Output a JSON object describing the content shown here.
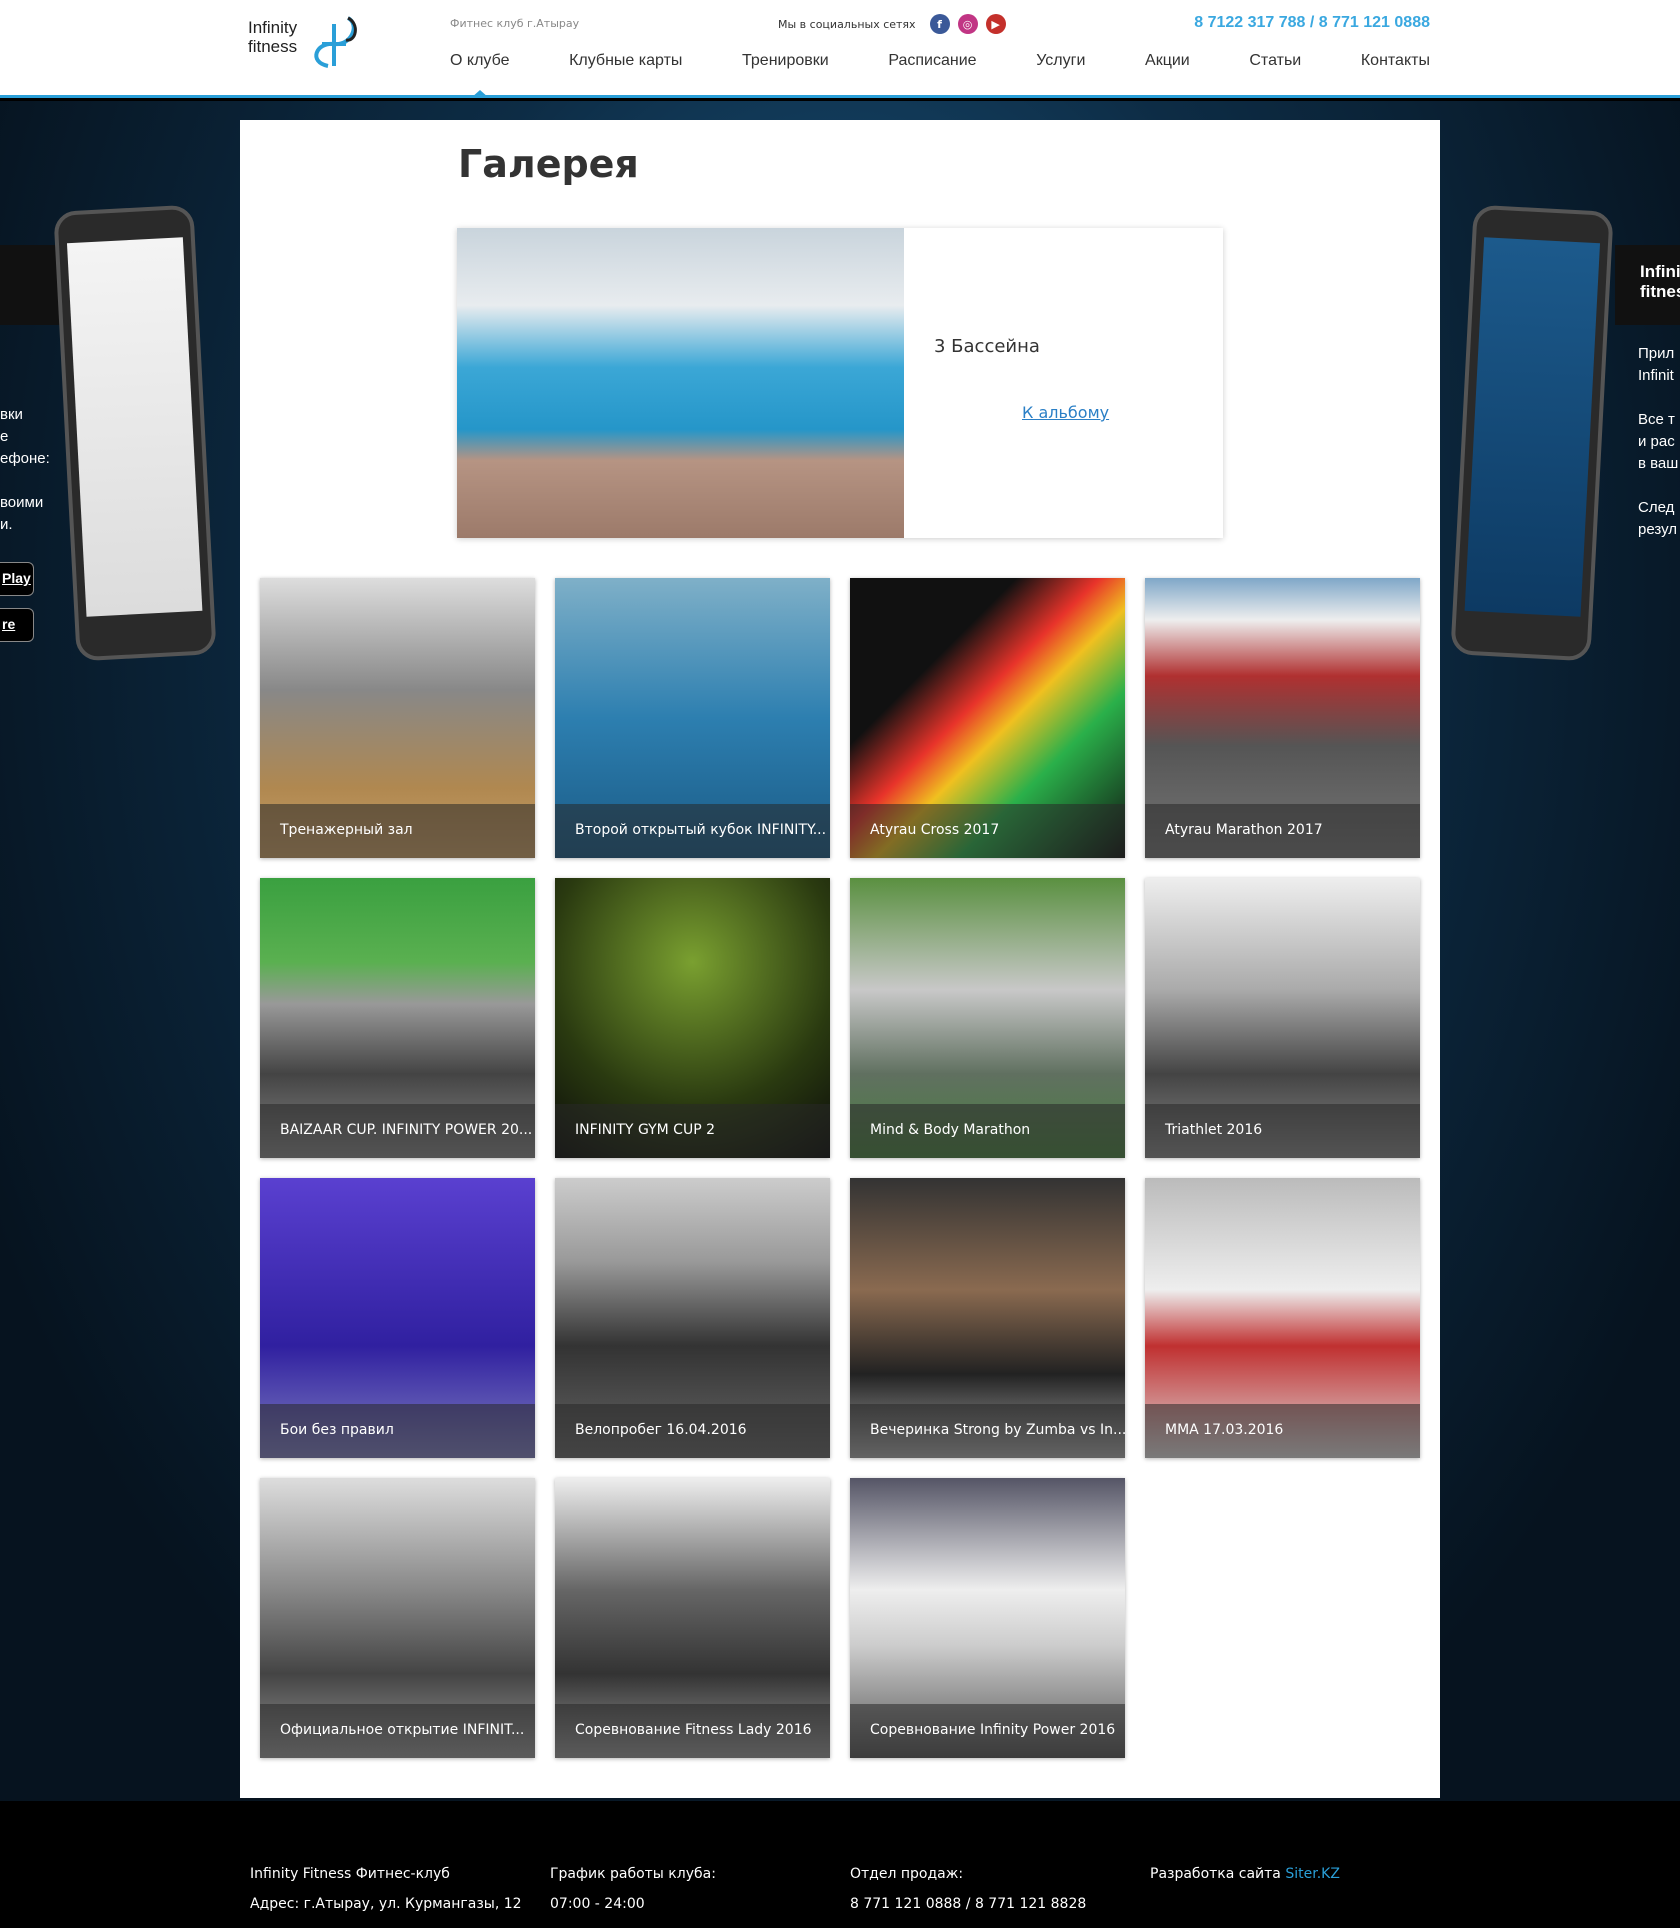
{
  "header": {
    "logo_text_1": "Infinity",
    "logo_text_2": "fitness",
    "tagline": "Фитнес клуб г.Атырау",
    "social_label": "Мы в социальных сетях",
    "social": [
      {
        "icon": "facebook-icon",
        "glyph": "f",
        "color": "#3b5998"
      },
      {
        "icon": "instagram-icon",
        "glyph": "◎",
        "color": "#c13584"
      },
      {
        "icon": "youtube-icon",
        "glyph": "▶",
        "color": "#c4302b"
      }
    ],
    "phone": "8 7122 317 788 / 8 771 121 0888",
    "accent": "#2a9fd8"
  },
  "nav": [
    "О клубе",
    "Клубные карты",
    "Тренировки",
    "Расписание",
    "Услуги",
    "Акции",
    "Статьи",
    "Контакты"
  ],
  "side": {
    "left_text": "вки\nе\nефоне:\n\nвоими\nи.",
    "left_btn1": "Play",
    "left_btn2": "re",
    "right_logo": "Infini\nfitnes",
    "right_text": "Прил\nInfinit\n\nВсе т\nи рас\nв ваш\n\nСлед\nрезул"
  },
  "main": {
    "title": "Галерея",
    "featured": {
      "name": "3 Бассейна",
      "link": "К альбому"
    },
    "albums": [
      {
        "title": "Тренажерный зал",
        "bg": "linear-gradient(#ddd 0%,#888 40%,#b08850 75%,#caa068 100%)"
      },
      {
        "title": "Второй открытый кубок INFINITY...",
        "bg": "linear-gradient(#7fb0c8,#2d7fb0 50%,#1a5a85)"
      },
      {
        "title": "Atyrau Cross 2017",
        "bg": "linear-gradient(135deg,#111 30%,#e8332a 45%,#f0c020 55%,#2ab04a 70%,#111)"
      },
      {
        "title": "Atyrau Marathon 2017",
        "bg": "linear-gradient(#7fa7c8 0%,#eee 15%,#b03030 35%,#555 60%,#777)"
      },
      {
        "title": "BAIZAAR CUP. INFINITY POWER 20...",
        "bg": "linear-gradient(#3aa040 0%,#5ab050 30%,#999 45%,#444 70%,#888)"
      },
      {
        "title": "INFINITY GYM CUP 2",
        "bg": "radial-gradient(circle at 50% 30%,#7aa030,#2a3a10 60%,#0a0a0a)"
      },
      {
        "title": "Mind & Body Marathon",
        "bg": "linear-gradient(#5a9040,#c8c8c8 40%,#607060 70%,#4a8040)"
      },
      {
        "title": "Triathlet 2016",
        "bg": "linear-gradient(#eee,#aaa 40%,#444 70%,#888)"
      },
      {
        "title": "Бои без правил",
        "bg": "linear-gradient(#5a40d0,#3020a0 60%,#8080c0)"
      },
      {
        "title": "Велопробег 16.04.2016",
        "bg": "linear-gradient(#ccc,#999 30%,#333 60%,#666)"
      },
      {
        "title": "Вечеринка Strong by Zumba vs In...",
        "bg": "linear-gradient(#333,#8a6a50 40%,#222 70%,#aaa)"
      },
      {
        "title": "MMA 17.03.2016",
        "bg": "linear-gradient(#bbb,#eee 40%,#c03030 60%,#ddd)"
      },
      {
        "title": "Официальное открытие INFINIT...",
        "bg": "linear-gradient(#ddd,#888 40%,#444 70%,#999)"
      },
      {
        "title": "Соревнование Fitness Lady 2016",
        "bg": "linear-gradient(#eee,#666 40%,#333 70%,#999)"
      },
      {
        "title": "Соревнование Infinity Power 2016",
        "bg": "linear-gradient(#556,#eee 40%,#ccc 60%,#555)"
      }
    ]
  },
  "footer": {
    "col1": [
      "Infinity Fitness Фитнес-клуб",
      "Адрес: г.Атырау, ул. Курмангазы, 12"
    ],
    "col2": [
      "График работы клуба:",
      "07:00 - 24:00"
    ],
    "col3": [
      "Отдел продаж:",
      "8 771 121 0888 / 8 771 121 8828"
    ],
    "col4_label": "Разработка сайта ",
    "col4_link": "Siter.KZ"
  }
}
